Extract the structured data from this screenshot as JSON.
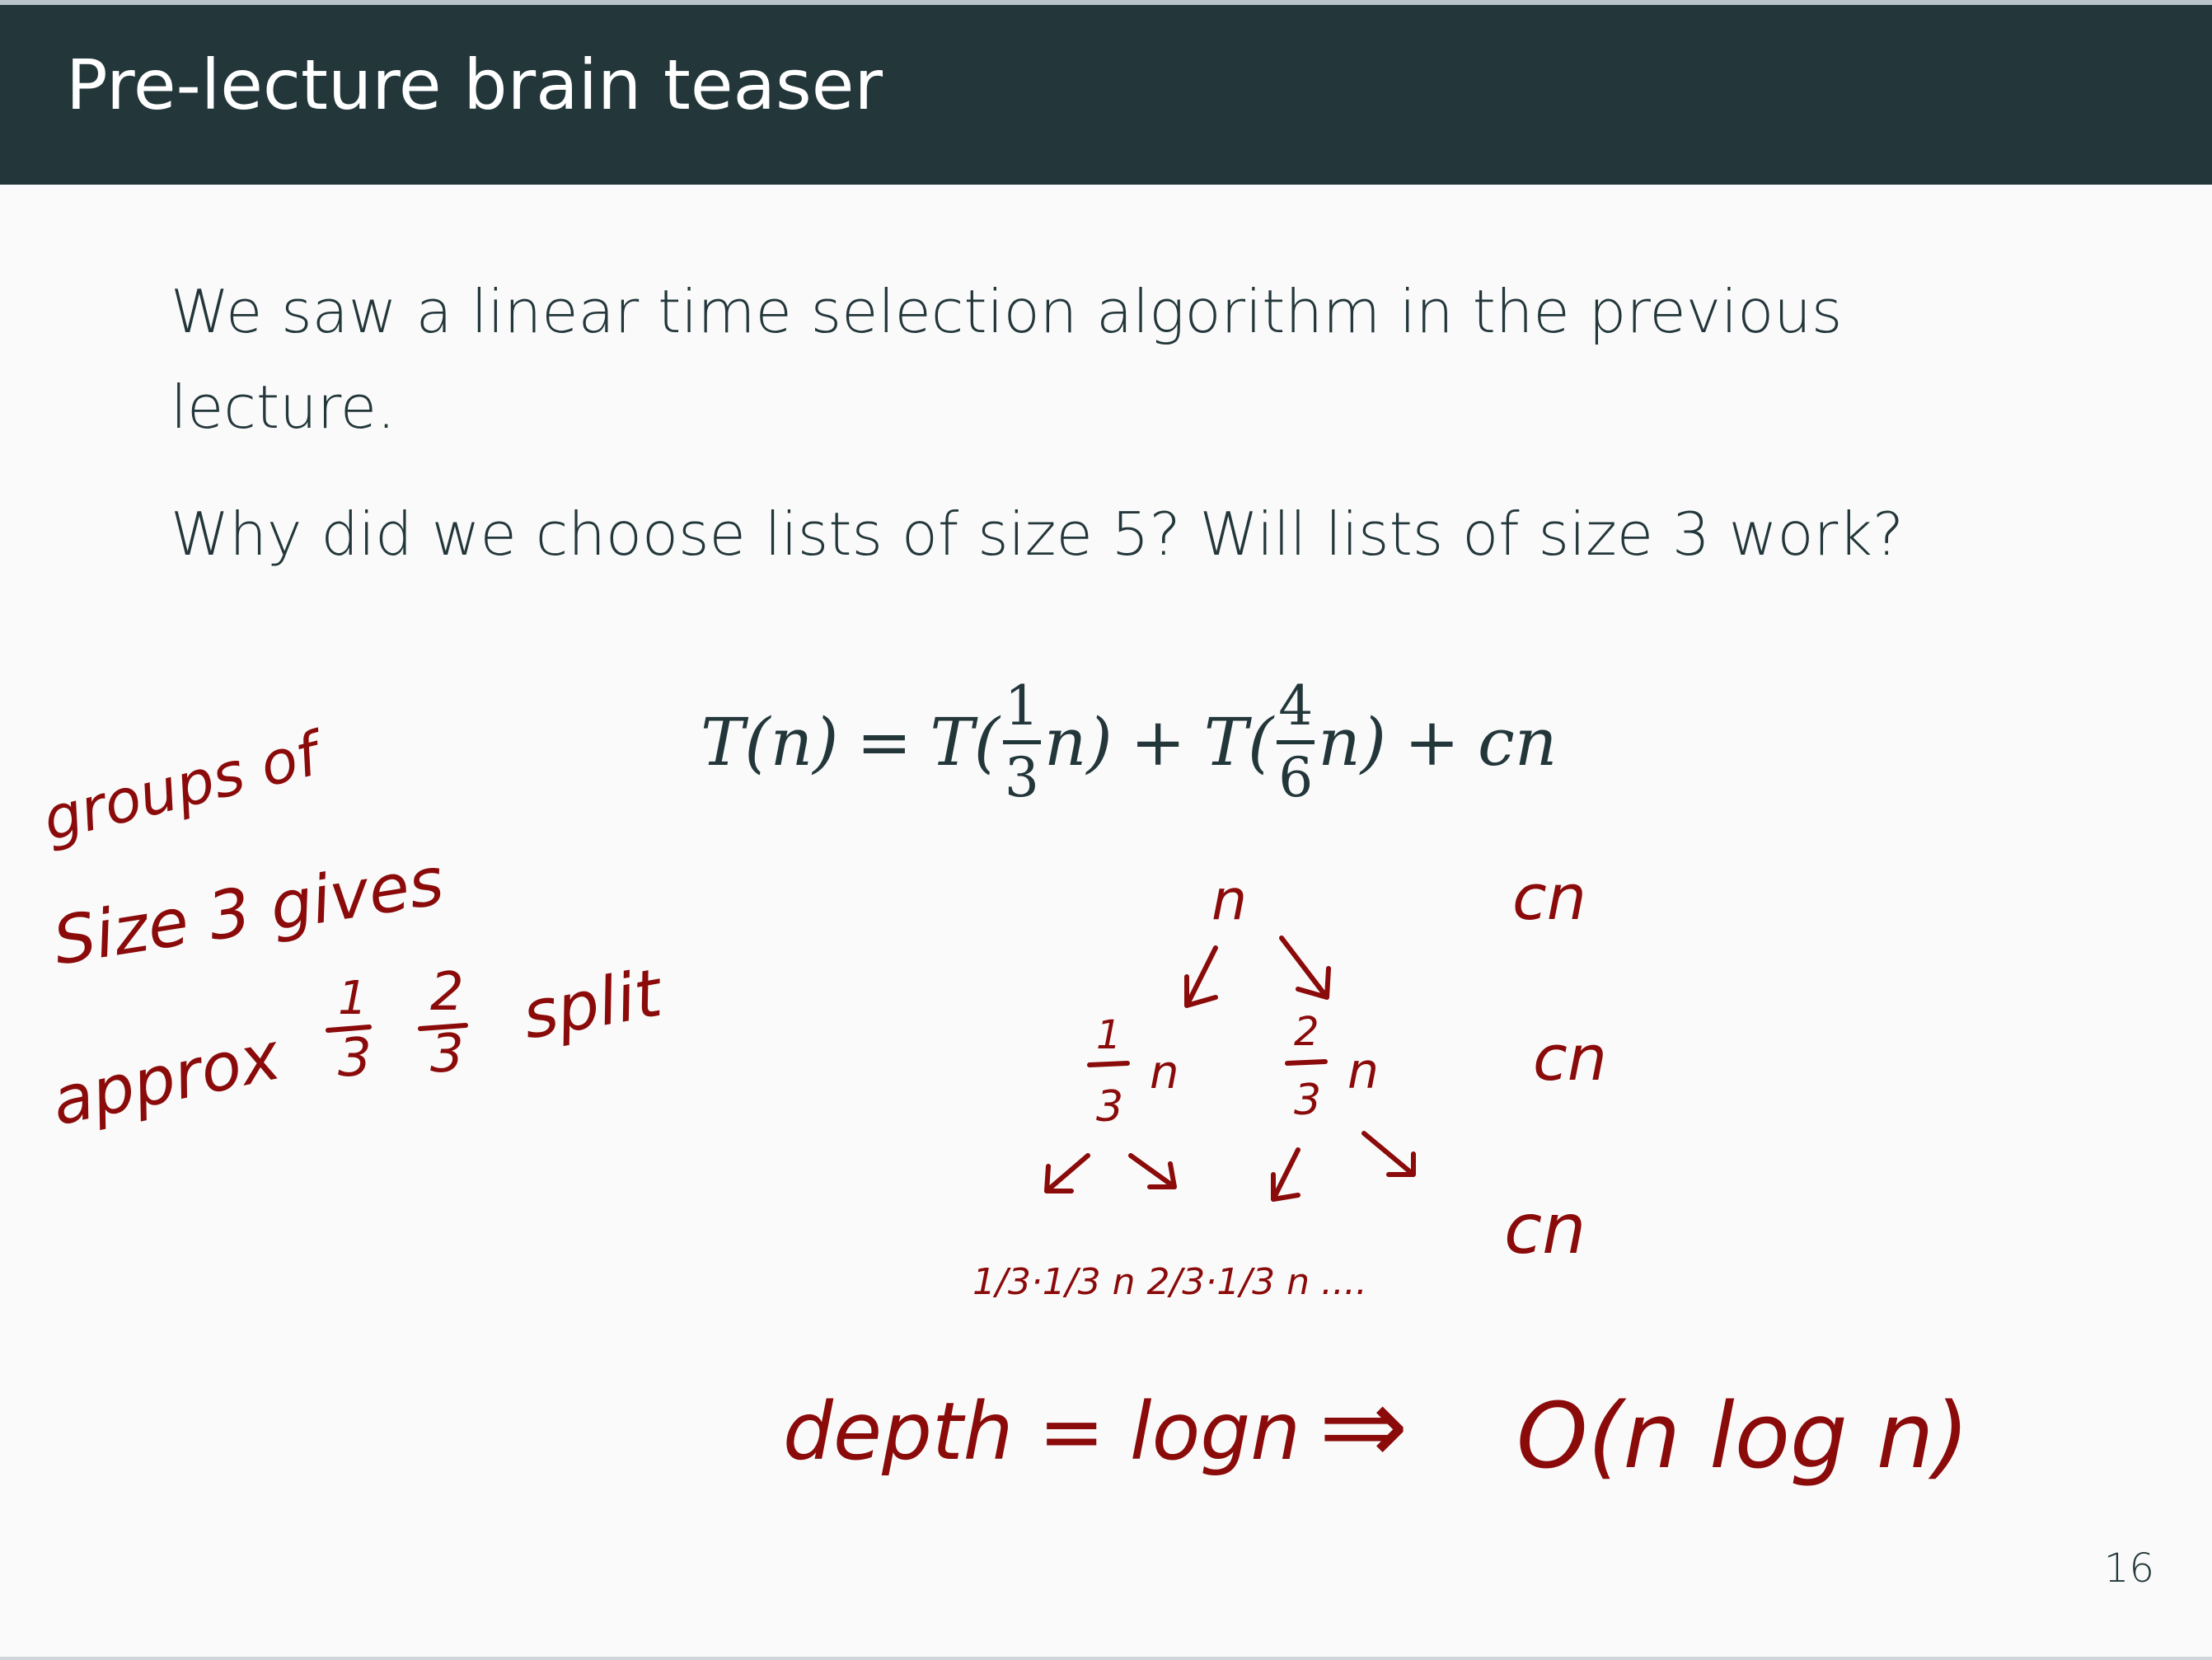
{
  "slide": {
    "title": "Pre-lecture brain teaser",
    "paragraphs": [
      "We saw a linear time selection algorithm in the previous lecture.",
      "Why did we choose lists of size 5? Will lists of size 3 work?"
    ],
    "page_number": "16"
  },
  "equation": {
    "lhs": "T(n)",
    "equals": "=",
    "T1": "T(",
    "frac1_num": "1",
    "frac1_den": "3",
    "n1": "n)",
    "plus1": "+",
    "T2": "T(",
    "frac2_num": "4",
    "frac2_den": "6",
    "n2": "n)",
    "plus2": "+",
    "cn": "cn"
  },
  "annotations": {
    "color": "#8b0a0a",
    "left_note": {
      "line1": "groups of",
      "line2": "Size 3 gives",
      "line3_prefix": "approx",
      "frac_a_num": "1",
      "frac_a_den": "3",
      "frac_b_num": "2",
      "frac_b_den": "3",
      "line3_suffix": "split"
    },
    "tree": {
      "root": "n",
      "level1_left": "n",
      "level1_left_frac": [
        "1",
        "3"
      ],
      "level1_right": "n",
      "level1_right_frac": [
        "2",
        "3"
      ],
      "level2_text": "1/3·1/3 n  2/3·1/3 n ....",
      "cost_labels": [
        "cn",
        "cn",
        "cn"
      ]
    },
    "conclusion": {
      "depth": "depth = logn",
      "implies": "⇒",
      "result": "O(n log n)"
    }
  }
}
